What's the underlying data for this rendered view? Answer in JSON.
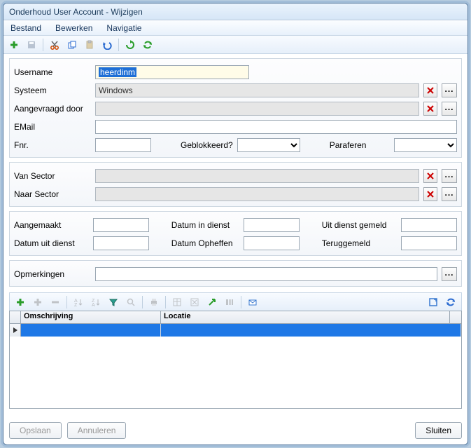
{
  "window": {
    "title": "Onderhoud User Account - Wijzigen"
  },
  "menu": {
    "file": "Bestand",
    "edit": "Bewerken",
    "nav": "Navigatie"
  },
  "form": {
    "username_label": "Username",
    "username_value": "heerdinm",
    "systeem_label": "Systeem",
    "systeem_value": "Windows",
    "aangevraagd_label": "Aangevraagd door",
    "aangevraagd_value": "",
    "email_label": "EMail",
    "email_value": "",
    "fnr_label": "Fnr.",
    "fnr_value": "",
    "geblok_label": "Geblokkeerd?",
    "geblok_value": "",
    "paraferen_label": "Paraferen",
    "paraferen_value": "",
    "van_sector_label": "Van Sector",
    "van_sector_value": "",
    "naar_sector_label": "Naar Sector",
    "naar_sector_value": "",
    "aangemaakt_label": "Aangemaakt",
    "aangemaakt_value": "",
    "datum_in_dienst_label": "Datum in dienst",
    "datum_in_dienst_value": "",
    "uit_dienst_gemeld_label": "Uit dienst gemeld",
    "uit_dienst_gemeld_value": "",
    "datum_uit_dienst_label": "Datum uit dienst",
    "datum_uit_dienst_value": "",
    "datum_opheffen_label": "Datum Opheffen",
    "datum_opheffen_value": "",
    "teruggemeld_label": "Teruggemeld",
    "teruggemeld_value": "",
    "opmerkingen_label": "Opmerkingen",
    "opmerkingen_value": ""
  },
  "grid": {
    "col1": "Omschrijving",
    "col2": "Locatie"
  },
  "buttons": {
    "save": "Opslaan",
    "cancel": "Annuleren",
    "close": "Sluiten",
    "ellipsis": "..."
  }
}
